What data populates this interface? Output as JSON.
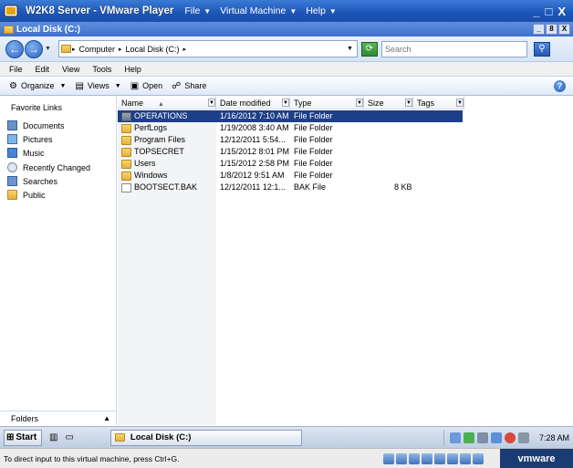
{
  "vm_window": {
    "title": "W2K8 Server - VMware Player",
    "menus": [
      "File",
      "Virtual Machine",
      "Help"
    ],
    "controls": [
      "_",
      "□",
      "X"
    ]
  },
  "explorer_window": {
    "title": "Local Disk (C:)",
    "controls": [
      "_",
      "8",
      "X"
    ]
  },
  "address_bar": {
    "crumbs": [
      "Computer",
      "Local Disk (C:)"
    ],
    "search_placeholder": "Search"
  },
  "menubar": [
    "File",
    "Edit",
    "View",
    "Tools",
    "Help"
  ],
  "command_bar": {
    "organize": "Organize",
    "views": "Views",
    "open": "Open",
    "share": "Share"
  },
  "left_pane": {
    "title": "Favorite Links",
    "items": [
      "Documents",
      "Pictures",
      "Music",
      "Recently Changed",
      "Searches",
      "Public"
    ],
    "folders_label": "Folders"
  },
  "columns": [
    "Name",
    "Date modified",
    "Type",
    "Size",
    "Tags"
  ],
  "files": [
    {
      "name": "OPERATIONS",
      "date": "1/16/2012 7:10 AM",
      "type": "File Folder",
      "size": "",
      "kind": "folder",
      "selected": true
    },
    {
      "name": "PerfLogs",
      "date": "1/19/2008 3:40 AM",
      "type": "File Folder",
      "size": "",
      "kind": "folder",
      "selected": false
    },
    {
      "name": "Program Files",
      "date": "12/12/2011 5:54...",
      "type": "File Folder",
      "size": "",
      "kind": "folder",
      "selected": false
    },
    {
      "name": "TOPSECRET",
      "date": "1/15/2012 8:01 PM",
      "type": "File Folder",
      "size": "",
      "kind": "folder",
      "selected": false
    },
    {
      "name": "Users",
      "date": "1/15/2012 2:58 PM",
      "type": "File Folder",
      "size": "",
      "kind": "folder",
      "selected": false
    },
    {
      "name": "Windows",
      "date": "1/8/2012 9:51 AM",
      "type": "File Folder",
      "size": "",
      "kind": "folder",
      "selected": false
    },
    {
      "name": "BOOTSECT.BAK",
      "date": "12/12/2011 12:1...",
      "type": "BAK File",
      "size": "8 KB",
      "kind": "file",
      "selected": false
    }
  ],
  "taskbar": {
    "start": "Start",
    "task_label": "Local Disk (C:)",
    "clock": "7:28 AM"
  },
  "vm_status": {
    "text": "To direct input to this virtual machine, press Ctrl+G.",
    "logo": "vmware"
  },
  "colors": {
    "vm_titlebar": "#1c55b8",
    "selection": "#1d3f88",
    "vmware_logo_bg": "#1a3c74"
  }
}
